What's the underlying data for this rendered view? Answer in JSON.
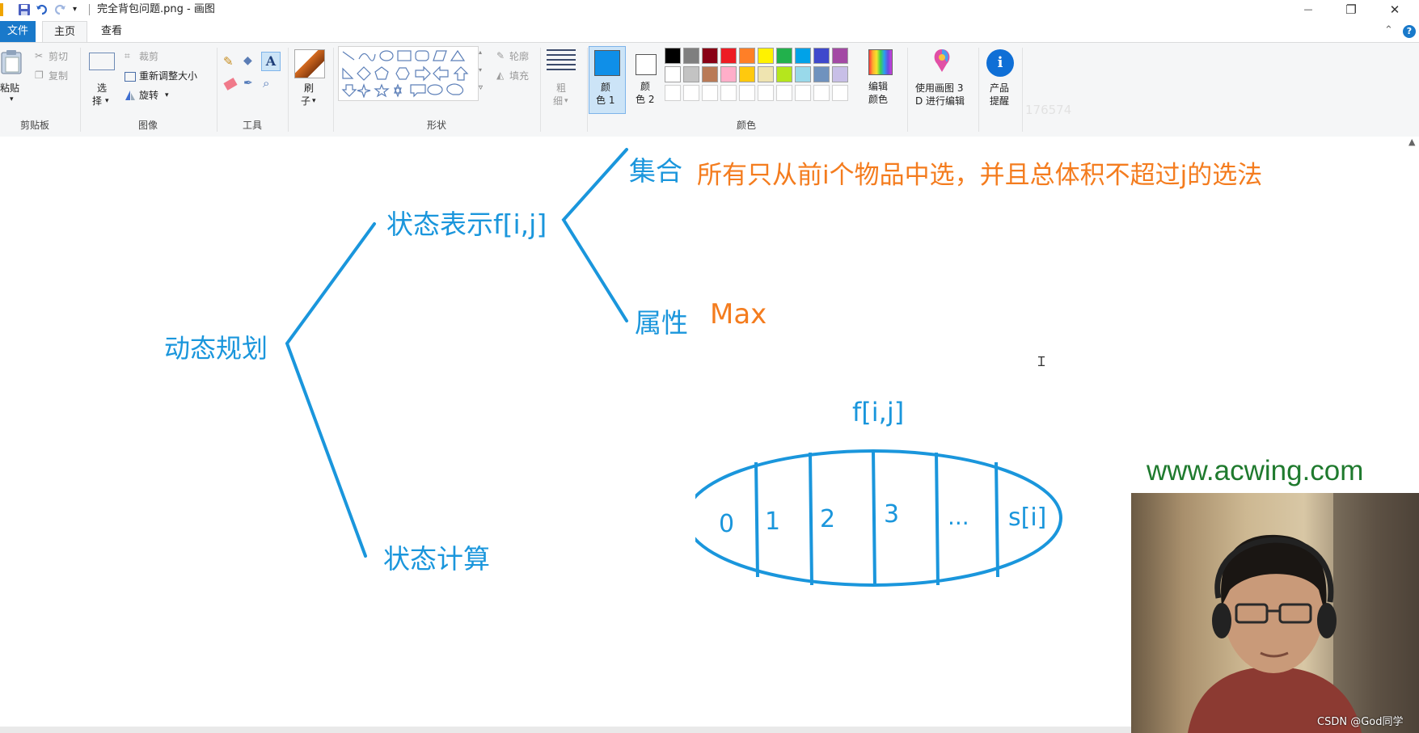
{
  "window": {
    "title": "完全背包问题.png - 画图",
    "minimize": "—",
    "maximize": "❐",
    "close": "✕"
  },
  "tabs": {
    "file": "文件",
    "home": "主页",
    "view": "查看"
  },
  "ribbon": {
    "clipboard": {
      "paste": "粘贴",
      "cut": "剪切",
      "copy": "复制",
      "group": "剪贴板"
    },
    "image": {
      "select": "选择",
      "select_line1": "选",
      "select_line2": "择",
      "crop": "裁剪",
      "resize": "重新调整大小",
      "rotate": "旋转",
      "group": "图像"
    },
    "tools": {
      "group": "工具"
    },
    "brushes": {
      "line1": "刷",
      "line2": "子"
    },
    "shapes": {
      "outline": "轮廓",
      "fill": "填充",
      "group": "形状"
    },
    "size": {
      "line1": "粗",
      "line2": "细"
    },
    "colors": {
      "color1_line1": "颜",
      "color1_line2": "色 1",
      "color2_line1": "颜",
      "color2_line2": "色 2",
      "edit_line1": "编辑",
      "edit_line2": "颜色",
      "group": "颜色",
      "color1": "#0f8fe8",
      "color2": "#ffffff",
      "palette_row1": [
        "#000000",
        "#7f7f7f",
        "#880015",
        "#ed1c24",
        "#ff7f27",
        "#fff200",
        "#22b14c",
        "#00a2e8",
        "#3f48cc",
        "#a349a4"
      ],
      "palette_row2": [
        "#ffffff",
        "#c3c3c3",
        "#b97a57",
        "#ffaec9",
        "#ffc90e",
        "#efe4b0",
        "#b5e61d",
        "#99d9ea",
        "#7092be",
        "#c8bfe7"
      ]
    },
    "paint3d": {
      "line1": "使用画图 3",
      "line2": "D 进行编辑"
    },
    "product": {
      "line1": "产品",
      "line2": "提醒"
    },
    "faint": "176574"
  },
  "diagram": {
    "root": "动态规划",
    "state_repr": "状态表示f[i,j]",
    "set_label": "集合",
    "set_desc": "所有只从前i个物品中选，并且总体积不超过j的选法",
    "attr_label": "属性",
    "attr_value": "Max",
    "state_calc": "状态计算",
    "ellipse_title": "f[i,j]",
    "partitions": [
      "0",
      "1",
      "2",
      "3",
      "...",
      "s[i]"
    ]
  },
  "watermark": {
    "site": "www.acwing.com",
    "csdn": "CSDN @God同学"
  },
  "colors": {
    "diagram_blue": "#1a96dc",
    "diagram_orange": "#f47c1e",
    "site_green": "#1f7a2e"
  }
}
